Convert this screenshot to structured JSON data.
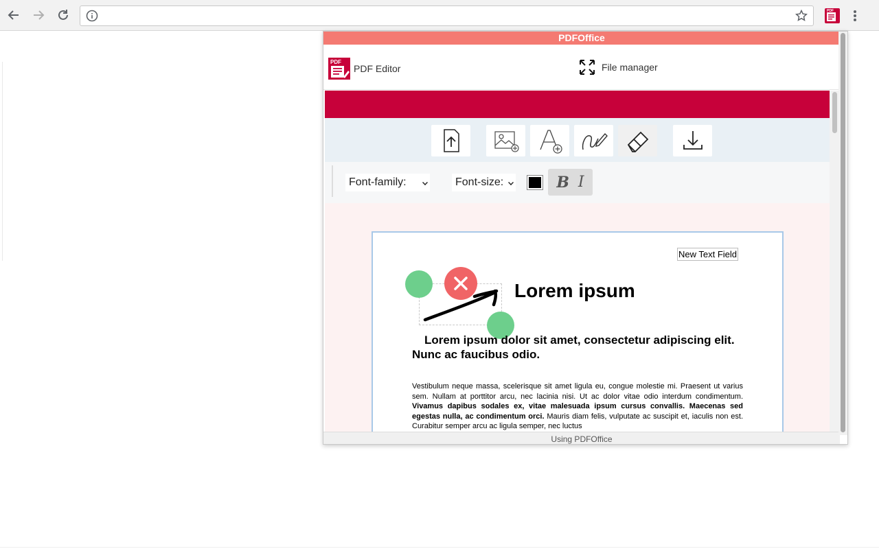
{
  "browser": {
    "address": ""
  },
  "popup": {
    "title": "PDFOffice",
    "nav": {
      "editor_label": "PDF Editor",
      "file_manager_label": "File manager"
    },
    "tools": [
      "upload-icon",
      "add-image-icon",
      "add-text-icon",
      "draw-icon",
      "eraser-icon",
      "download-icon"
    ],
    "format": {
      "font_family_label": "Font-family:",
      "font_size_label": "Font-size:",
      "color": "#000000",
      "bold_label": "B",
      "italic_label": "I"
    },
    "document": {
      "text_field": "New Text Field",
      "heading": "Lorem ipsum",
      "subheading": "Lorem ipsum dolor sit amet, consectetur adipiscing elit. Nunc ac faucibus odio.",
      "body_normal_1": "Vestibulum neque massa, scelerisque sit amet ligula eu, congue molestie mi. Praesent ut varius sem. Nullam at porttitor arcu, nec lacinia nisi. Ut ac dolor vitae odio interdum condimentum. ",
      "body_bold": "Vivamus dapibus sodales ex, vitae malesuada ipsum cursus convallis. Maecenas sed egestas nulla, ac condimentum orci.",
      "body_normal_2": " Mauris diam felis, vulputate ac suscipit et, iaculis non est. Curabitur semper arcu ac ligula semper, nec luctus"
    },
    "footer": "Using PDFOffice"
  },
  "colors": {
    "title_bar": "#f47a72",
    "brand_red": "#c7013a",
    "handle_green": "#6dcf8c",
    "close_red": "#f06466"
  }
}
